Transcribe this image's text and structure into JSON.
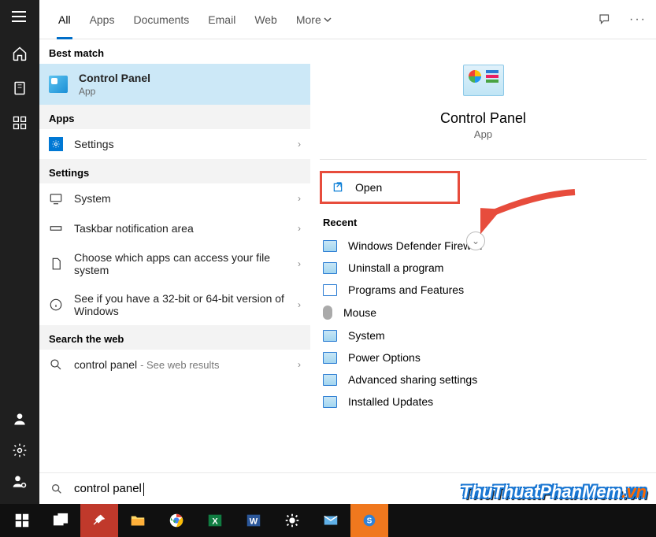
{
  "tabs": {
    "all": "All",
    "apps": "Apps",
    "documents": "Documents",
    "email": "Email",
    "web": "Web",
    "more": "More"
  },
  "sections": {
    "best_match": "Best match",
    "apps": "Apps",
    "settings": "Settings",
    "search_web": "Search the web"
  },
  "best_match": {
    "title": "Control Panel",
    "sub": "App"
  },
  "apps_list": [
    {
      "title": "Settings"
    }
  ],
  "settings_list": [
    {
      "title": "System"
    },
    {
      "title": "Taskbar notification area"
    },
    {
      "title": "Choose which apps can access your file system"
    },
    {
      "title": "See if you have a 32-bit or 64-bit version of Windows"
    }
  ],
  "web_search": {
    "query": "control panel",
    "suffix": "- See web results"
  },
  "hero": {
    "title": "Control Panel",
    "sub": "App"
  },
  "action_open": "Open",
  "recent_header": "Recent",
  "recent": [
    "Windows Defender Firewall",
    "Uninstall a program",
    "Programs and Features",
    "Mouse",
    "System",
    "Power Options",
    "Advanced sharing settings",
    "Installed Updates"
  ],
  "search_query": "control panel",
  "watermark": {
    "a": "ThuThuatPhanMem",
    "b": ".vn"
  }
}
